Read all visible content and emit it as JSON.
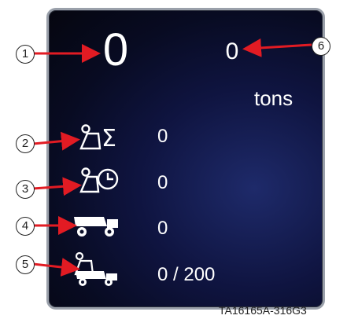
{
  "display": {
    "load_count_big": "0",
    "payload_value": "0",
    "payload_unit": "tons",
    "rows": [
      {
        "icon": "payload-sum-icon",
        "value": "0"
      },
      {
        "icon": "payload-clock-icon",
        "value": "0"
      },
      {
        "icon": "dump-truck-icon",
        "value": "0"
      },
      {
        "icon": "truck-loading-icon",
        "value": "0 / 200"
      }
    ]
  },
  "callouts": [
    "1",
    "2",
    "3",
    "4",
    "5",
    "6"
  ],
  "figure_id": "TA16165A-316G3",
  "colors": {
    "arrow": "#e21b23",
    "text": "#ffffff"
  }
}
